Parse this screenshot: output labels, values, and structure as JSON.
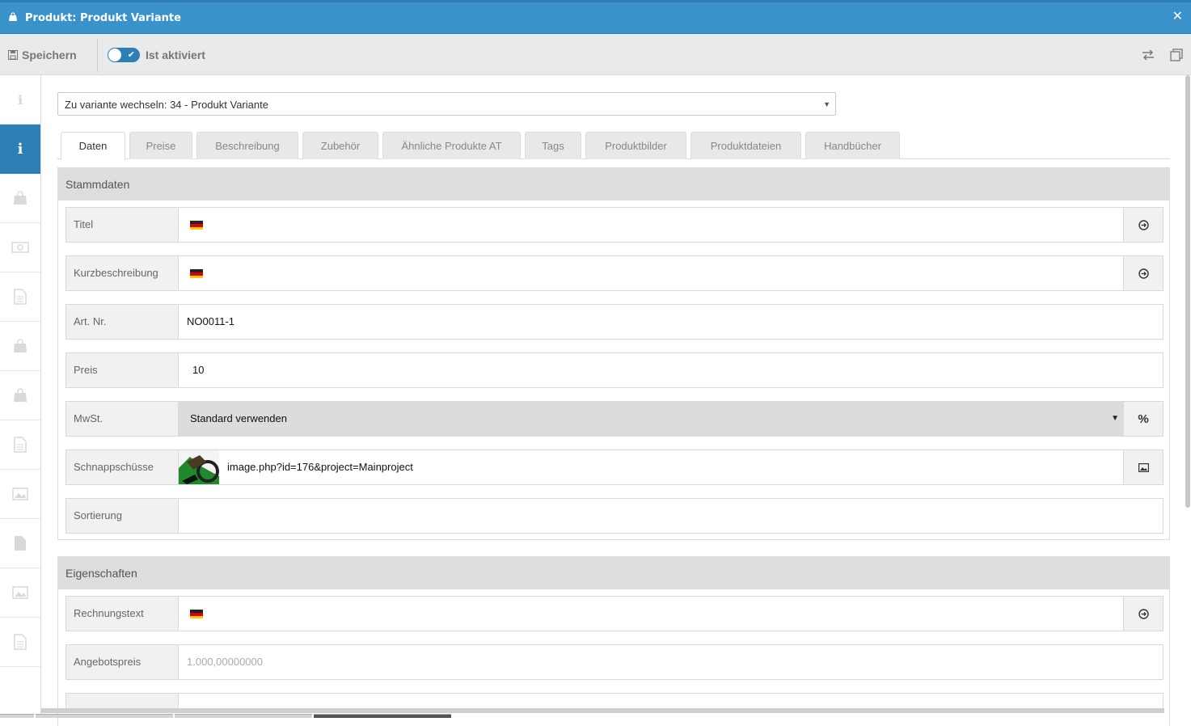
{
  "window": {
    "title": "Produkt: Produkt Variante",
    "title_icon": "shopping-bag-icon",
    "close_glyph": "✕",
    "title_bg": "#3a92cb"
  },
  "toolbar": {
    "save_label": "Speichern",
    "active_label": "Ist aktiviert",
    "active_state": true,
    "right_icons": [
      "arrows-exchange-icon",
      "clone-icon"
    ]
  },
  "sidebar": {
    "items": [
      {
        "icon": "info-icon",
        "active": false
      },
      {
        "icon": "info-icon",
        "active": true
      },
      {
        "icon": "shopping-bag-icon",
        "active": false
      },
      {
        "icon": "money-icon",
        "active": false
      },
      {
        "icon": "file-icon",
        "active": false
      },
      {
        "icon": "shopping-bag-icon",
        "active": false
      },
      {
        "icon": "shopping-bag-icon",
        "active": false
      },
      {
        "icon": "file-icon",
        "active": false
      },
      {
        "icon": "image-icon",
        "active": false
      },
      {
        "icon": "file-icon",
        "active": false
      },
      {
        "icon": "image-icon",
        "active": false
      },
      {
        "icon": "file-icon",
        "active": false
      }
    ]
  },
  "variant_select": {
    "value": "Zu variante wechseln: 34 - Produkt Variante"
  },
  "tabs": [
    {
      "label": "Daten",
      "active": true
    },
    {
      "label": "Preise",
      "active": false
    },
    {
      "label": "Beschreibung",
      "active": false
    },
    {
      "label": "Zubehör",
      "active": false
    },
    {
      "label": "Ähnliche Produkte AT",
      "active": false
    },
    {
      "label": "Tags",
      "active": false
    },
    {
      "label": "Produktbilder",
      "active": false
    },
    {
      "label": "Produktdateien",
      "active": false
    },
    {
      "label": "Handbücher",
      "active": false
    }
  ],
  "stammdaten": {
    "heading": "Stammdaten",
    "fields": {
      "titel": {
        "label": "Titel",
        "value": "",
        "flag": "de-flag-icon",
        "addon_icon": "arrow-circle-right-icon"
      },
      "kurzbeschreibung": {
        "label": "Kurzbeschreibung",
        "value": "",
        "flag": "de-flag-icon",
        "addon_icon": "arrow-circle-right-icon"
      },
      "artnr": {
        "label": "Art. Nr.",
        "value": "NO0011-1"
      },
      "preis": {
        "label": "Preis",
        "value": "10"
      },
      "mwst": {
        "label": "MwSt.",
        "value": "Standard verwenden",
        "addon_glyph": "%"
      },
      "schnappschuesse": {
        "label": "Schnappschüsse",
        "value": "image.php?id=176&project=Mainproject",
        "addon_icon": "image-icon"
      },
      "sortierung": {
        "label": "Sortierung",
        "value": ""
      }
    }
  },
  "eigenschaften": {
    "heading": "Eigenschaften",
    "fields": {
      "rechnungstext": {
        "label": "Rechnungstext",
        "value": "",
        "flag": "de-flag-icon",
        "addon_icon": "arrow-circle-right-icon"
      },
      "angebotspreis": {
        "label": "Angebotspreis",
        "placeholder": "1.000,00000000"
      }
    }
  },
  "colors": {
    "accent": "#2d7fb6",
    "panel_head": "#dddddd",
    "label_bg": "#f1f1f1"
  }
}
